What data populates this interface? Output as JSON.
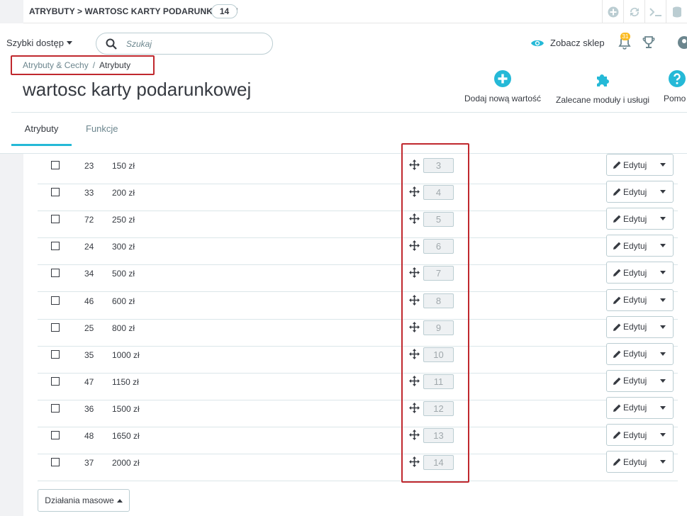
{
  "topbar": {
    "title": "ATRYBUTY > WARTOSC KARTY PODARUNKOWEJ",
    "count": "14",
    "icons": [
      "plus-circle-icon",
      "refresh-icon",
      "terminal-icon",
      "database-icon"
    ]
  },
  "header": {
    "quick_access": "Szybki dostęp",
    "search_placeholder": "Szukaj",
    "view_shop": "Zobacz sklep",
    "notifications_count": "31"
  },
  "breadcrumb": {
    "parent": "Atrybuty & Cechy",
    "separator": "/",
    "current": "Atrybuty"
  },
  "page_title": "wartosc karty podarunkowej",
  "toolbar": {
    "add_label": "Dodaj nową wartość",
    "modules_label": "Zalecane moduły i usługi",
    "help_label": "Pomo"
  },
  "tabs": {
    "attributes": "Atrybuty",
    "features": "Funkcje"
  },
  "table": {
    "edit_label": "Edytuj",
    "rows": [
      {
        "id": "23",
        "name": "150 zł",
        "position": "3"
      },
      {
        "id": "33",
        "name": "200 zł",
        "position": "4"
      },
      {
        "id": "72",
        "name": "250 zł",
        "position": "5"
      },
      {
        "id": "24",
        "name": "300 zł",
        "position": "6"
      },
      {
        "id": "34",
        "name": "500 zł",
        "position": "7"
      },
      {
        "id": "46",
        "name": "600 zł",
        "position": "8"
      },
      {
        "id": "25",
        "name": "800 zł",
        "position": "9"
      },
      {
        "id": "35",
        "name": "1000 zł",
        "position": "10"
      },
      {
        "id": "47",
        "name": "1150 zł",
        "position": "11"
      },
      {
        "id": "36",
        "name": "1500 zł",
        "position": "12"
      },
      {
        "id": "48",
        "name": "1650 zł",
        "position": "13"
      },
      {
        "id": "37",
        "name": "2000 zł",
        "position": "14"
      }
    ]
  },
  "bulk_actions": "Działania masowe",
  "colors": {
    "accent": "#25b9d7",
    "highlight": "#c0282e",
    "badge": "#fbbb22"
  }
}
